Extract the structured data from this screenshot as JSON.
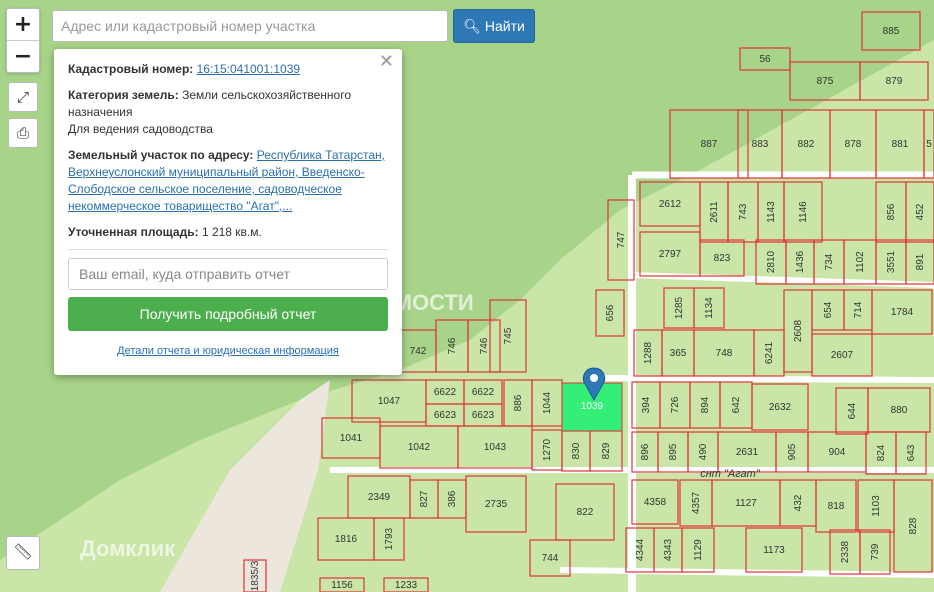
{
  "search": {
    "placeholder": "Адрес или кадастровый номер участка",
    "button_label": "Найти",
    "button_icon": "search-icon"
  },
  "controls": {
    "zoom_in": "+",
    "zoom_out": "−",
    "fullscreen_icon": "expand-icon",
    "print_icon": "print-icon",
    "ruler_icon": "ruler-icon"
  },
  "popup": {
    "cadastral_label": "Кадастровый номер:",
    "cadastral_value": "16:15:041001:1039",
    "category_label": "Категория земель:",
    "category_value": "Земли сельскохозяйственного назначения",
    "usage": "Для ведения садоводства",
    "address_label": "Земельный участок по адресу:",
    "address_value": "Республика Татарстан, Верхнеуслонский муниципальный район, Введенско-Слободское сельское поселение, садоводческое некоммерческое товарищество \"Агат\",...",
    "area_label": "Уточненная площадь:",
    "area_value": "1 218 кв.м.",
    "email_placeholder": "Ваш email, куда отправить отчет",
    "get_button": "Получить подробный отчет",
    "details_link": "Детали отчета и юридическая информация",
    "close": "✕"
  },
  "watermarks": {
    "nedvizhimost": "НЕДВИЖИМОСТИ",
    "domklik": "Домклик"
  },
  "street_label": "снт \"Агат\"",
  "selected_parcel": "1039",
  "colors": {
    "selected": "#33ee77",
    "parcel_line": "#e0323a",
    "land": "#c9e6a8"
  },
  "parcels": [
    {
      "id": "885"
    },
    {
      "id": "56"
    },
    {
      "id": "875"
    },
    {
      "id": "879"
    },
    {
      "id": "887"
    },
    {
      "id": "883"
    },
    {
      "id": "882"
    },
    {
      "id": "878"
    },
    {
      "id": "881"
    },
    {
      "id": "5"
    },
    {
      "id": "2612"
    },
    {
      "id": "2611"
    },
    {
      "id": "743"
    },
    {
      "id": "1143"
    },
    {
      "id": "1146"
    },
    {
      "id": "856"
    },
    {
      "id": "452"
    },
    {
      "id": "747"
    },
    {
      "id": "2797"
    },
    {
      "id": "823"
    },
    {
      "id": "2810"
    },
    {
      "id": "1436"
    },
    {
      "id": "734"
    },
    {
      "id": "1102"
    },
    {
      "id": "3551"
    },
    {
      "id": "891"
    },
    {
      "id": "656"
    },
    {
      "id": "1285"
    },
    {
      "id": "1134"
    },
    {
      "id": "2608"
    },
    {
      "id": "654"
    },
    {
      "id": "714"
    },
    {
      "id": "1784"
    },
    {
      "id": "742"
    },
    {
      "id": "746"
    },
    {
      "id": "746"
    },
    {
      "id": "745"
    },
    {
      "id": "1288"
    },
    {
      "id": "365"
    },
    {
      "id": "748"
    },
    {
      "id": "6241"
    },
    {
      "id": "2607"
    },
    {
      "id": "1047"
    },
    {
      "id": "6622"
    },
    {
      "id": "6622"
    },
    {
      "id": "6623"
    },
    {
      "id": "6623"
    },
    {
      "id": "886"
    },
    {
      "id": "1044"
    },
    {
      "id": "1039"
    },
    {
      "id": "394"
    },
    {
      "id": "726"
    },
    {
      "id": "894"
    },
    {
      "id": "642"
    },
    {
      "id": "2632"
    },
    {
      "id": "644"
    },
    {
      "id": "880"
    },
    {
      "id": "1041"
    },
    {
      "id": "1042"
    },
    {
      "id": "1043"
    },
    {
      "id": "1270"
    },
    {
      "id": "830"
    },
    {
      "id": "829"
    },
    {
      "id": "896"
    },
    {
      "id": "895"
    },
    {
      "id": "490"
    },
    {
      "id": "2631"
    },
    {
      "id": "905"
    },
    {
      "id": "904"
    },
    {
      "id": "824"
    },
    {
      "id": "643"
    },
    {
      "id": "2349"
    },
    {
      "id": "827"
    },
    {
      "id": "386"
    },
    {
      "id": "2735"
    },
    {
      "id": "822"
    },
    {
      "id": "4358"
    },
    {
      "id": "4357"
    },
    {
      "id": "1127"
    },
    {
      "id": "432"
    },
    {
      "id": "818"
    },
    {
      "id": "1103"
    },
    {
      "id": "828"
    },
    {
      "id": "1816"
    },
    {
      "id": "1793"
    },
    {
      "id": "744"
    },
    {
      "id": "4344"
    },
    {
      "id": "4343"
    },
    {
      "id": "1129"
    },
    {
      "id": "1173"
    },
    {
      "id": "2338"
    },
    {
      "id": "739"
    },
    {
      "id": "1835/3"
    },
    {
      "id": "1156"
    },
    {
      "id": "1233"
    }
  ]
}
